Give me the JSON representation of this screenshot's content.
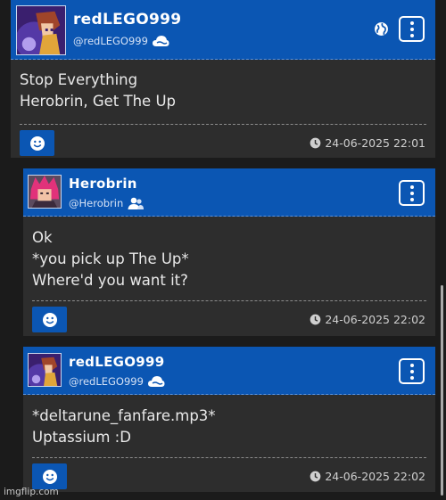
{
  "posts": [
    {
      "username": "redLEGO999",
      "handle": "@redLEGO999",
      "avatar": "anime-character-avatar",
      "badge_icon": "cloud-icon",
      "visibility_icon": "globe-icon",
      "menu_icon": "more-vertical-icon",
      "lines": [
        "Stop Everything",
        "Herobrin, Get The Up"
      ],
      "react_icon": "smiley-icon",
      "clock_icon": "clock-icon",
      "timestamp": "24-06-2025 22:01"
    },
    {
      "username": "Herobrin",
      "handle": "@Herobrin",
      "avatar": "pink-hair-character-avatar",
      "badge_icon": "users-icon",
      "menu_icon": "more-vertical-icon",
      "lines": [
        "Ok",
        "*you pick up The Up*",
        "Where'd you want it?"
      ],
      "react_icon": "smiley-icon",
      "clock_icon": "clock-icon",
      "timestamp": "24-06-2025 22:02"
    },
    {
      "username": "redLEGO999",
      "handle": "@redLEGO999",
      "avatar": "anime-character-avatar",
      "badge_icon": "cloud-icon",
      "menu_icon": "more-vertical-icon",
      "lines": [
        "*deltarune_fanfare.mp3*",
        "Uptassium :D"
      ],
      "react_icon": "smiley-icon",
      "clock_icon": "clock-icon",
      "timestamp": "24-06-2025 22:02"
    }
  ],
  "watermark": "imgflip.com",
  "colors": {
    "header_blue": "#0b56b3",
    "card_bg": "#2d2d2d",
    "page_bg": "#1b1b1b",
    "text": "#e9e9e9"
  }
}
